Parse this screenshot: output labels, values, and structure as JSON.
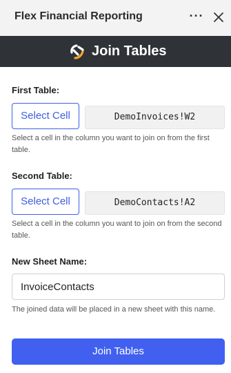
{
  "titlebar": {
    "title": "Flex Financial Reporting",
    "more_icon": "more-horizontal-icon",
    "more_glyph": "···",
    "close_icon": "close-icon"
  },
  "header": {
    "logo_icon": "flex-logo-icon",
    "title": "Join Tables",
    "background": "#2f3338"
  },
  "first_table": {
    "label": "First Table:",
    "button_label": "Select Cell",
    "cell_ref": "DemoInvoices!W2",
    "help": "Select a cell in the column you want to join on from the first table."
  },
  "second_table": {
    "label": "Second Table:",
    "button_label": "Select Cell",
    "cell_ref": "DemoContacts!A2",
    "help": "Select a cell in the column you want to join on from the second table."
  },
  "new_sheet": {
    "label": "New Sheet Name:",
    "value": "InvoiceContacts",
    "help": "The joined data will be placed in a new sheet with this name."
  },
  "action": {
    "join_label": "Join Tables"
  },
  "colors": {
    "accent": "#3c5fe0",
    "primary_button": "#4160f0"
  }
}
